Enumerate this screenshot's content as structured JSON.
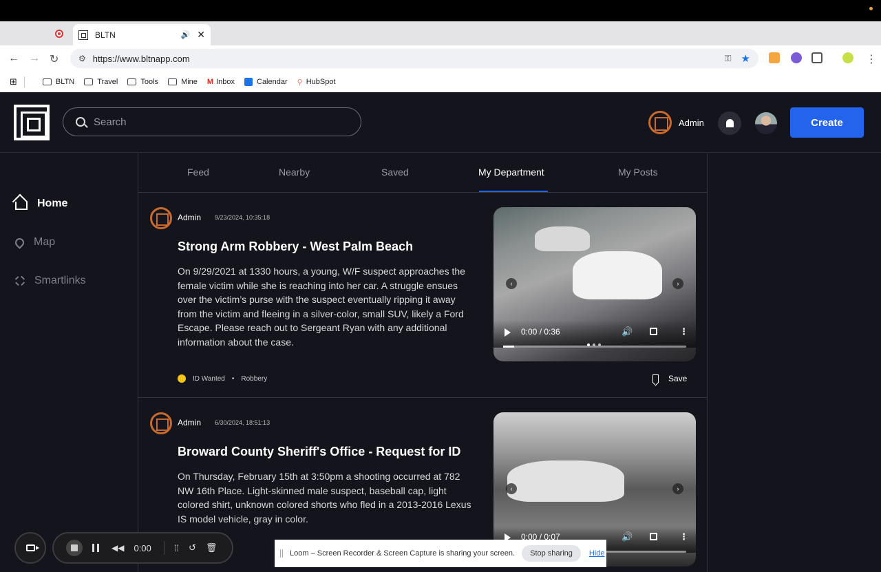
{
  "browser": {
    "tab_title": "BLTN",
    "url": "https://www.bltnapp.com",
    "bookmarks": [
      "BLTN",
      "Travel",
      "Tools",
      "Mine",
      "Inbox",
      "Calendar",
      "HubSpot"
    ]
  },
  "header": {
    "search_placeholder": "Search",
    "department_label": "Admin",
    "create_label": "Create"
  },
  "sidebar": {
    "items": [
      {
        "label": "Home",
        "icon": "home-icon",
        "active": true
      },
      {
        "label": "Map",
        "icon": "map-pin-icon",
        "active": false
      },
      {
        "label": "Smartlinks",
        "icon": "link-icon",
        "active": false
      }
    ]
  },
  "feed_tabs": [
    {
      "label": "Feed",
      "active": false
    },
    {
      "label": "Nearby",
      "active": false
    },
    {
      "label": "Saved",
      "active": false
    },
    {
      "label": "My Department",
      "active": true
    },
    {
      "label": "My Posts",
      "active": false
    }
  ],
  "posts": [
    {
      "author": "Admin",
      "date": "9/23/2024, 10:35:18",
      "title": "Strong Arm Robbery - West Palm Beach",
      "body": "On 9/29/2021 at 1330 hours, a young, W/F suspect approaches the female victim while she is reaching into her car. A struggle ensues over the victim’s purse with the suspect eventually ripping it away from the victim and fleeing in a silver-color, small SUV, likely a Ford Escape. Please reach out to Sergeant Ryan with any additional information about the case.",
      "tag_status": "ID Wanted",
      "tag_category": "Robbery",
      "save_label": "Save",
      "video_time": "0:00 / 0:36"
    },
    {
      "author": "Admin",
      "date": "6/30/2024, 18:51:13",
      "title": "Broward County Sheriff's Office - Request for ID",
      "body": "On Thursday, February 15th at 3:50pm a shooting occurred at 782 NW 16th Place. Light-skinned male suspect, baseball cap, light colored shirt, unknown colored shorts who fled in a 2013-2016 Lexus IS model vehicle, gray in color.",
      "video_time": "0:00 / 0:07"
    }
  ],
  "loom": {
    "timer": "0:00",
    "share_message": "Loom – Screen Recorder & Screen Capture is sharing your screen.",
    "stop_label": "Stop sharing",
    "hide_label": "Hide"
  },
  "colors": {
    "app_bg": "#14141c",
    "accent": "#2463eb",
    "dept_orange": "#c96a2c",
    "tag_yellow": "#f5c518"
  }
}
